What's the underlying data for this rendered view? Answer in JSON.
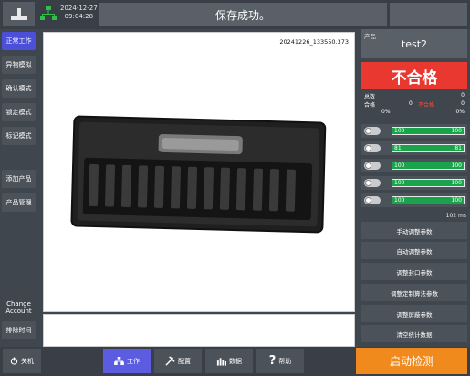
{
  "header": {
    "date": "2024-12-27",
    "time": "09:04:28",
    "status_message": "保存成功。"
  },
  "sidebar": {
    "items": [
      {
        "label": "正常工作"
      },
      {
        "label": "异物模拟"
      },
      {
        "label": "确认模式"
      },
      {
        "label": "锁定模式"
      },
      {
        "label": "标记模式"
      },
      {
        "label": "添加产品"
      },
      {
        "label": "产品管理"
      },
      {
        "label": "Change Account"
      },
      {
        "label": "排除时间"
      }
    ]
  },
  "image_view": {
    "stamp": "20241226_133550.373"
  },
  "product": {
    "label": "产品",
    "name": "test2",
    "result": "不合格"
  },
  "stats": {
    "total_label": "总数",
    "total_value": "0",
    "pass_label": "合格",
    "pass_value": "0",
    "fail_label": "不合格",
    "fail_value": "0",
    "pass_pct": "0%",
    "fail_pct": "0%"
  },
  "meters": [
    {
      "left": "100",
      "right": "100"
    },
    {
      "left": "81",
      "right": "81"
    },
    {
      "left": "100",
      "right": "100"
    },
    {
      "left": "100",
      "right": "100"
    },
    {
      "left": "100",
      "right": "100"
    }
  ],
  "timing": "102 ms",
  "params": [
    {
      "label": "手动调整参数"
    },
    {
      "label": "自动调整参数"
    },
    {
      "label": "调整封口参数"
    },
    {
      "label": "调整定制算法参数"
    },
    {
      "label": "调整屏蔽参数"
    },
    {
      "label": "清空统计数据"
    }
  ],
  "bottom": {
    "shutdown": "关机",
    "work": "工作",
    "config": "配置",
    "data": "数据",
    "help": "帮助",
    "start": "启动检测"
  },
  "colors": {
    "accent": "#4c4fd8",
    "fail": "#e8382f",
    "meter": "#19a34a",
    "start": "#f08a1c"
  }
}
